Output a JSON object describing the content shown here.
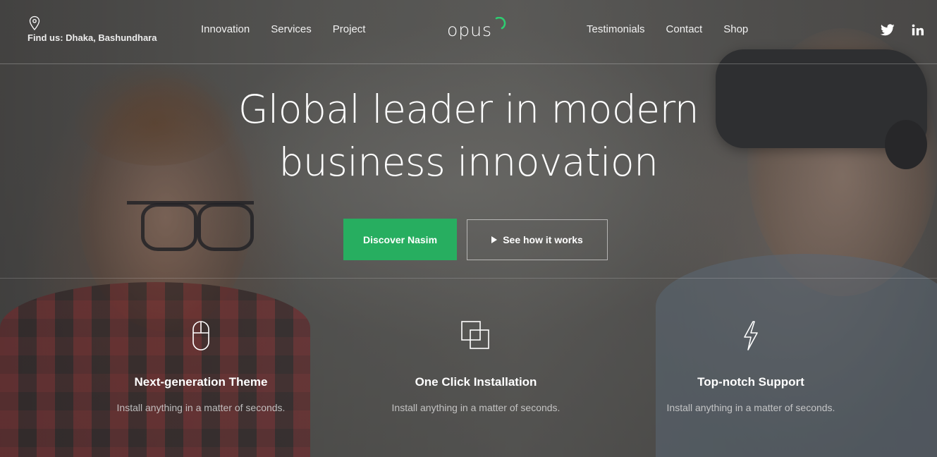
{
  "header": {
    "location_text": "Find us: Dhaka, Bashundhara",
    "nav_left": [
      "Innovation",
      "Services",
      "Project"
    ],
    "logo_text": "opus",
    "nav_right": [
      "Testimonials",
      "Contact",
      "Shop"
    ],
    "social_icons": [
      "twitter-icon",
      "linkedin-icon"
    ]
  },
  "hero": {
    "title_line1": "Global leader in modern",
    "title_line2": "business innovation",
    "primary_button": "Discover Nasim",
    "secondary_button": "See how it works"
  },
  "features": [
    {
      "icon": "mouse-icon",
      "title": "Next-generation Theme",
      "description": "Install anything in a matter of seconds."
    },
    {
      "icon": "overlapping-squares-icon",
      "title": "One Click Installation",
      "description": "Install anything in a matter of seconds."
    },
    {
      "icon": "lightning-bolt-icon",
      "title": "Top-notch Support",
      "description": "Install anything in a matter of seconds."
    }
  ],
  "colors": {
    "accent": "#27ae60",
    "logo_swoosh": "#2ecc71"
  }
}
